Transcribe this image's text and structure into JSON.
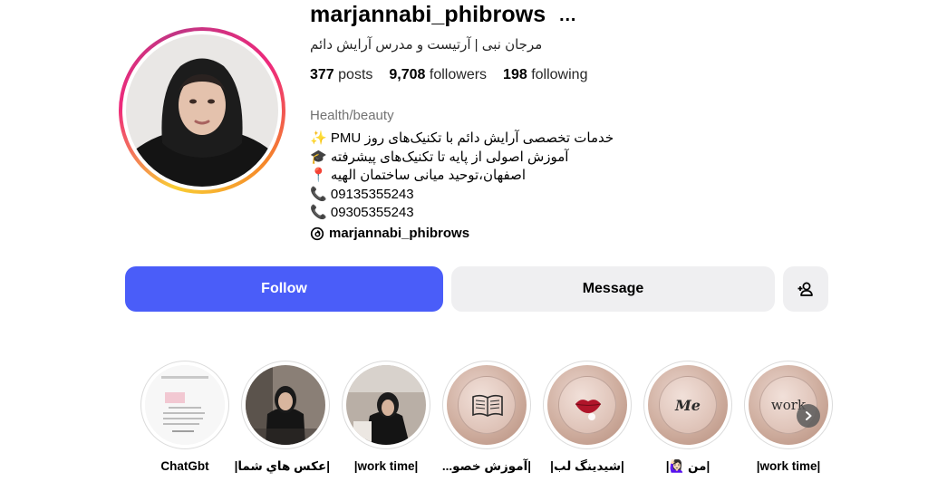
{
  "profile": {
    "username": "marjannabi_phibrows",
    "more_icon": "…",
    "full_name": "مرجان نبی | آرتیست و مدرس آرایش دائم",
    "stats": [
      {
        "count": "377",
        "label": "posts"
      },
      {
        "count": "9,708",
        "label": "followers"
      },
      {
        "count": "198",
        "label": "following"
      }
    ],
    "category": "Health/beauty",
    "bio_lines": [
      "خدمات تخصصی آرایش دائم با تکنیک‌های روز PMU ✨",
      "آموزش اصولی از پایه تا تکنیک‌های پیشرفته 🎓",
      "اصفهان،توحید میانی ساختمان الهیه 📍",
      "09135355243 📞",
      "09305355243 📞"
    ],
    "threads_handle": "marjannabi_phibrows"
  },
  "actions": {
    "follow_label": "Follow",
    "message_label": "Message"
  },
  "highlights": [
    {
      "label": "ChatGbt"
    },
    {
      "label": "|عکس هاي شما|"
    },
    {
      "label": "|work time|"
    },
    {
      "label": "|آموزش خصو..."
    },
    {
      "label": "|شیدینگ لب|"
    },
    {
      "label": "|من 🙋🏻‍♀️|"
    },
    {
      "label": "|work time|"
    }
  ],
  "highlight_cover_text": {
    "me": "Me",
    "work": "work"
  },
  "colors": {
    "follow_button": "#4a5df9",
    "secondary_button": "#efeff1",
    "category_text": "#737373"
  }
}
